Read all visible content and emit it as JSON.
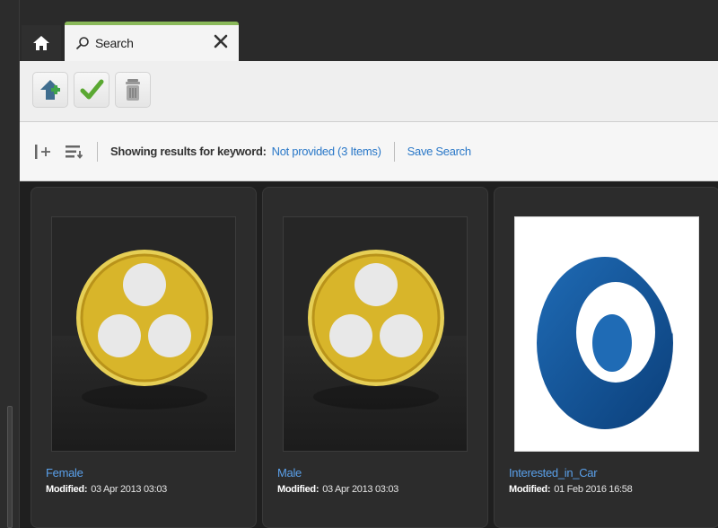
{
  "tabs": {
    "home_icon": "home-icon",
    "search_tab_label": "Search",
    "close_icon": "close-icon"
  },
  "toolbar": {
    "buttons": [
      {
        "name": "add-button",
        "icon": "add-icon"
      },
      {
        "name": "confirm-button",
        "icon": "checkmark-icon"
      },
      {
        "name": "delete-button",
        "icon": "trash-icon"
      }
    ]
  },
  "results": {
    "label": "Showing results for keyword:",
    "keyword_value": "Not provided (3 Items)",
    "save_search": "Save Search"
  },
  "cards": [
    {
      "name": "Female",
      "modified_label": "Modified:",
      "modified_value": "03 Apr 2013 03:03",
      "thumb": "segment-icon"
    },
    {
      "name": "Male",
      "modified_label": "Modified:",
      "modified_value": "03 Apr 2013 03:03",
      "thumb": "segment-icon"
    },
    {
      "name": "Interested_in_Car",
      "modified_label": "Modified:",
      "modified_value": "01 Feb 2016 16:58",
      "thumb": "wave-logo"
    }
  ],
  "colors": {
    "accent": "#2a78c8",
    "tab_active_border": "#8ab95a",
    "segment_gold": "#d8b52a"
  }
}
